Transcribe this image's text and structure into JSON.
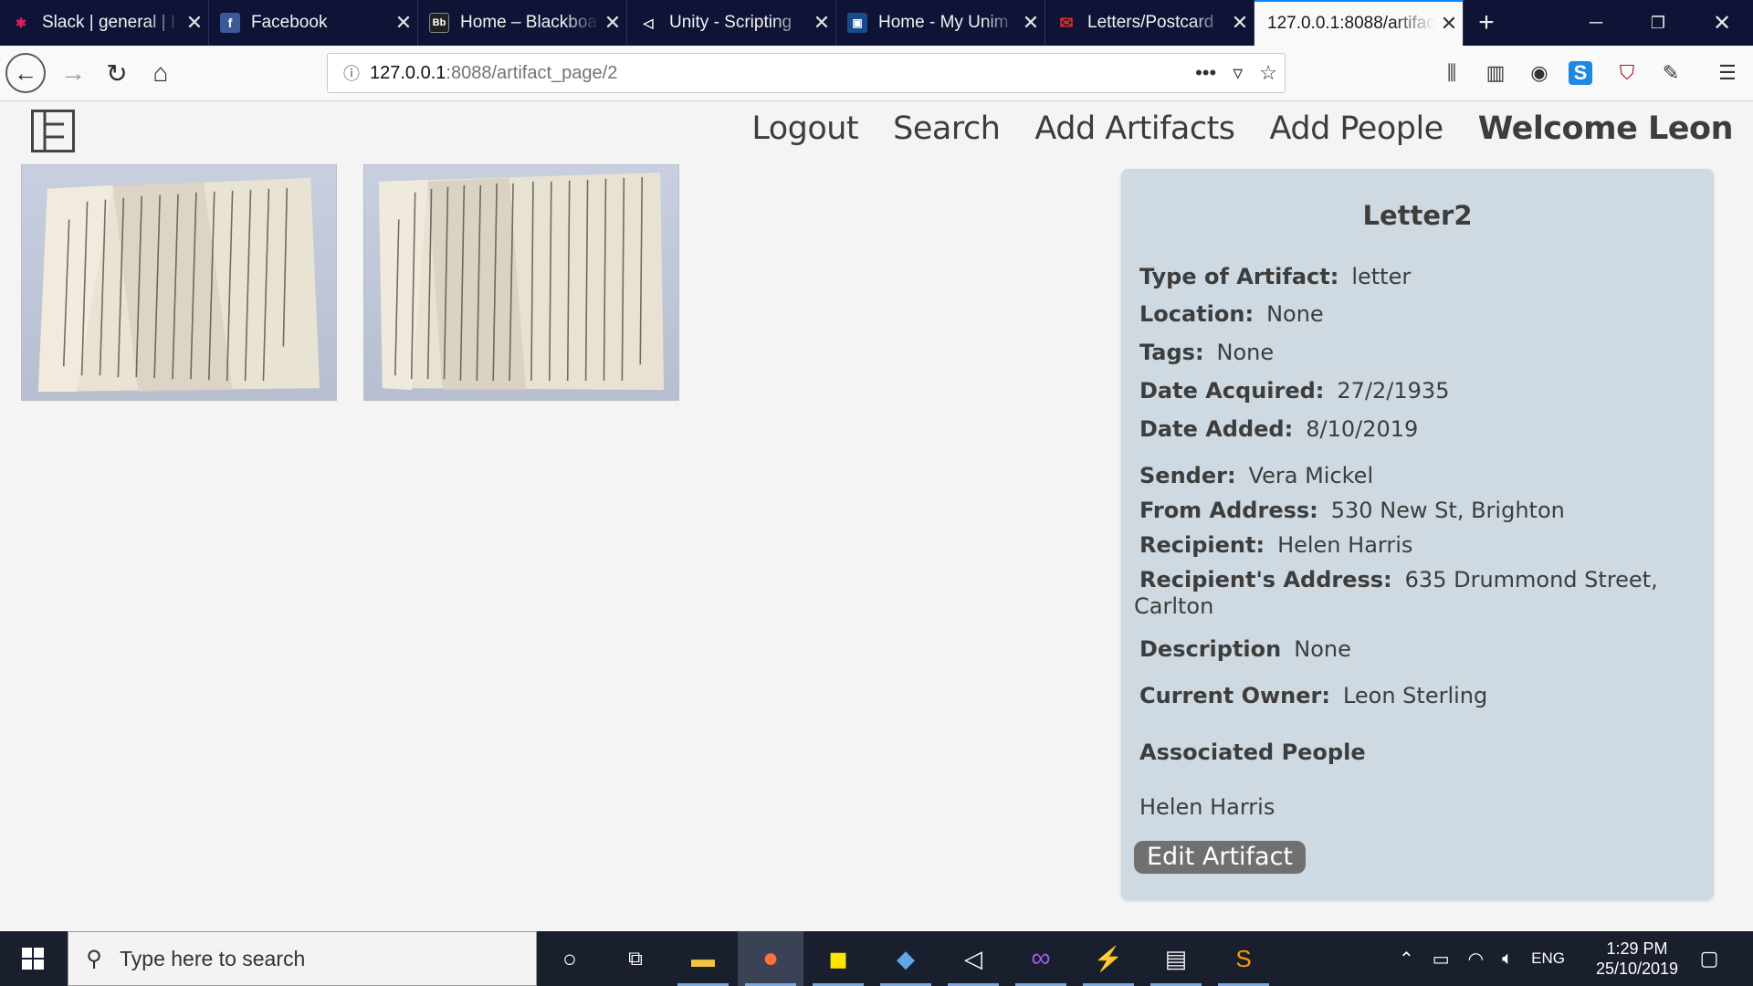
{
  "browser": {
    "tabs": [
      {
        "title": "Slack | general | I",
        "icon": "slack-icon"
      },
      {
        "title": "Facebook",
        "icon": "facebook-icon"
      },
      {
        "title": "Home – Blackboa",
        "icon": "blackboard-icon"
      },
      {
        "title": "Unity - Scripting",
        "icon": "unity-icon"
      },
      {
        "title": "Home - My Unim",
        "icon": "university-icon"
      },
      {
        "title": "Letters/Postcard",
        "icon": "gmail-icon"
      },
      {
        "title": "127.0.0.1:8088/artifac",
        "icon": "none",
        "active": true
      }
    ],
    "url_host": "127.0.0.1",
    "url_path": ":8088/artifact_page/2",
    "accent": "#0a84ff"
  },
  "site": {
    "nav": {
      "logout": "Logout",
      "search": "Search",
      "add_artifacts": "Add Artifacts",
      "add_people": "Add People",
      "welcome": "Welcome Leon"
    }
  },
  "artifact": {
    "title": "Letter2",
    "fields": {
      "type_label": "Type of Artifact:",
      "type_value": "letter",
      "location_label": "Location:",
      "location_value": "None",
      "tags_label": "Tags:",
      "tags_value": "None",
      "date_acquired_label": "Date Acquired:",
      "date_acquired_value": "27/2/1935",
      "date_added_label": "Date Added:",
      "date_added_value": "8/10/2019",
      "sender_label": "Sender:",
      "sender_value": "Vera Mickel",
      "from_address_label": "From Address:",
      "from_address_value": "530 New St, Brighton",
      "recipient_label": "Recipient:",
      "recipient_value": "Helen Harris",
      "recipient_address_label": "Recipient's Address:",
      "recipient_address_value": "635 Drummond Street,",
      "recipient_address_value_2": "Carlton",
      "description_label": "Description",
      "description_value": "None",
      "current_owner_label": "Current Owner:",
      "current_owner_value": "Leon Sterling"
    },
    "associated_people_title": "Associated People",
    "associated_people": [
      "Helen Harris"
    ],
    "edit_button": "Edit Artifact"
  },
  "taskbar": {
    "search_placeholder": "Type here to search",
    "language": "ENG",
    "time": "1:29 PM",
    "date": "25/10/2019"
  }
}
